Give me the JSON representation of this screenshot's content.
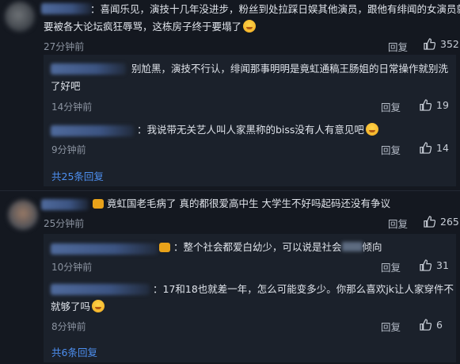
{
  "colors": {
    "background": "#141820",
    "thread_bg": "#1b212b",
    "link": "#4d8ff0",
    "muted": "#8b93a0"
  },
  "comments": [
    {
      "text_line1": "：喜闻乐见，演技十几年没进步，粉丝到处拉踩日娱其他演员，跟他有绯闻的女演员就",
      "text_line2": "要被各大论坛疯狂辱骂，这栋房子终于要塌了",
      "time": "27分钟前",
      "reply_label": "回复",
      "likes": "352",
      "replies": [
        {
          "text_line1": "别尬黑，演技不行认，绯闻那事明明是竟虹通稿王肠姐的日常操作就别洗",
          "text_line2": "了好吧",
          "time": "14分钟前",
          "reply_label": "回复",
          "likes": "19"
        },
        {
          "text_line1": "：我说带无关艺人叫人家黑称的biss没有人有意见吧",
          "time": "9分钟前",
          "reply_label": "回复",
          "likes": "14"
        }
      ],
      "expand_label": "共25条回复"
    },
    {
      "text_line1": "竟虹国老毛病了 真的都很爱高中生 大学生不好吗起码还没有争议",
      "time": "25分钟前",
      "reply_label": "回复",
      "likes": "265",
      "replies": [
        {
          "text_line1": "：整个社会都爱白幼少，可以说是社会",
          "text_line1_tail": "倾向",
          "time": "10分钟前",
          "reply_label": "回复",
          "likes": "31"
        },
        {
          "text_line1": "：17和18也就差一年，怎么可能变多少。你那么喜欢jk让人家穿件不",
          "text_line2": "就够了吗",
          "time": "8分钟前",
          "reply_label": "回复",
          "likes": "6"
        }
      ],
      "expand_label": "共6条回复"
    }
  ]
}
